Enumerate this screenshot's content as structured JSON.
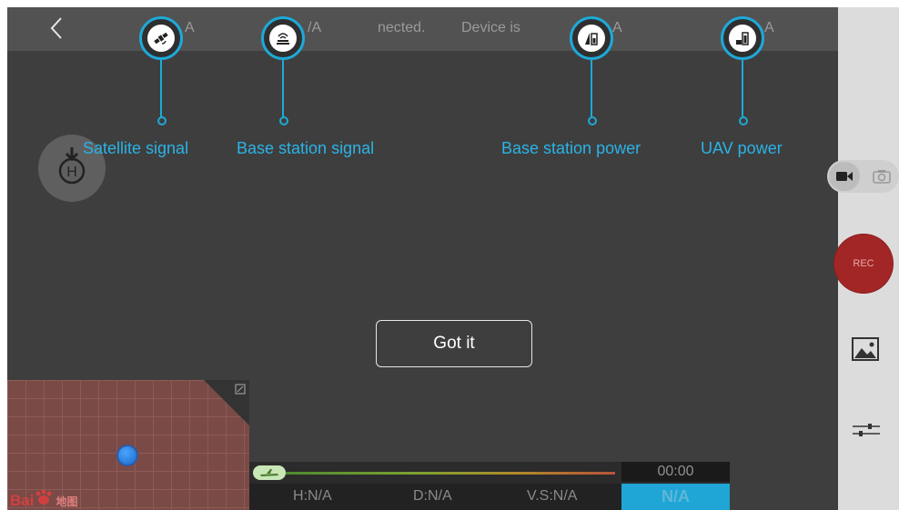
{
  "topbar": {
    "back_label": "‹",
    "status_fragments": [
      "A",
      "/A",
      "nected.",
      "Device is",
      "A",
      "A"
    ]
  },
  "callouts": [
    {
      "label": "Satellite signal",
      "icon": "satellite-icon"
    },
    {
      "label": "Base station signal",
      "icon": "base-station-signal-icon"
    },
    {
      "label": "Base station power",
      "icon": "base-station-power-icon"
    },
    {
      "label": "UAV power",
      "icon": "uav-battery-icon"
    }
  ],
  "dialog": {
    "confirm_label": "Got it"
  },
  "rightpanel": {
    "rec_label": "REC",
    "selected_mode": "video"
  },
  "map": {
    "logo_text": "Bai",
    "logo_cn": "地图"
  },
  "telemetry": {
    "timer": "00:00",
    "height": "H:N/A",
    "distance": "D:N/A",
    "vspeed": "V.S:N/A",
    "speed_value": "N/A"
  },
  "colors": {
    "accent": "#1ea9d8",
    "rec": "#a32626",
    "background": "#3e3e3e"
  }
}
